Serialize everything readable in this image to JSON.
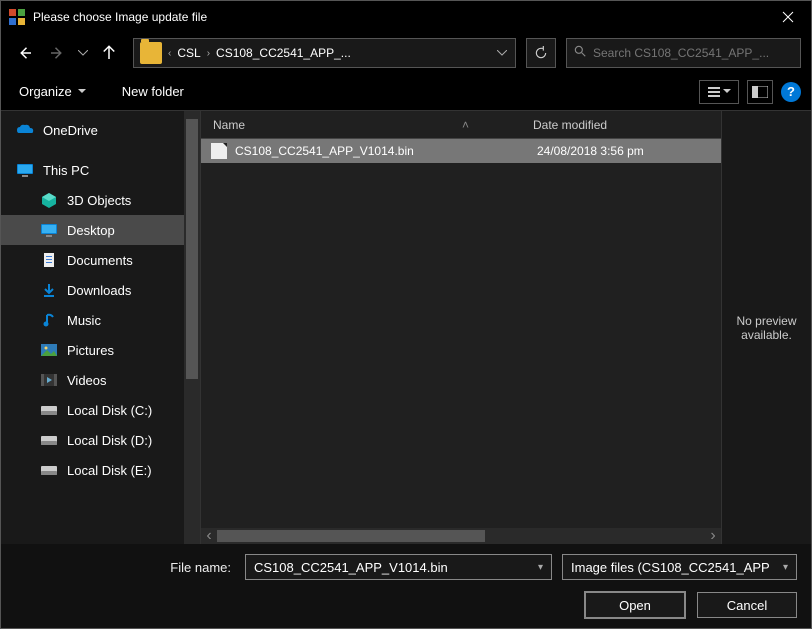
{
  "title": "Please choose Image update file",
  "breadcrumbs": [
    "CSL",
    "CS108_CC2541_APP_..."
  ],
  "search_placeholder": "Search CS108_CC2541_APP_...",
  "toolbar": {
    "organize": "Organize",
    "newfolder": "New folder",
    "help_symbol": "?"
  },
  "columns": {
    "name": "Name",
    "date": "Date modified"
  },
  "sidebar": [
    {
      "label": "OneDrive",
      "kind": "onedrive",
      "level": 0
    },
    {
      "label": "This PC",
      "kind": "thispc",
      "level": 0
    },
    {
      "label": "3D Objects",
      "kind": "3d",
      "level": 2
    },
    {
      "label": "Desktop",
      "kind": "desktop",
      "level": 2,
      "selected": true
    },
    {
      "label": "Documents",
      "kind": "docs",
      "level": 2
    },
    {
      "label": "Downloads",
      "kind": "downloads",
      "level": 2
    },
    {
      "label": "Music",
      "kind": "music",
      "level": 2
    },
    {
      "label": "Pictures",
      "kind": "pictures",
      "level": 2
    },
    {
      "label": "Videos",
      "kind": "videos",
      "level": 2
    },
    {
      "label": "Local Disk (C:)",
      "kind": "disk",
      "level": 2
    },
    {
      "label": "Local Disk (D:)",
      "kind": "disk",
      "level": 2
    },
    {
      "label": "Local Disk (E:)",
      "kind": "disk",
      "level": 2
    }
  ],
  "files": [
    {
      "name": "CS108_CC2541_APP_V1014.bin",
      "date": "24/08/2018 3:56 pm",
      "selected": true
    }
  ],
  "preview_text": "No preview available.",
  "footer": {
    "filename_label": "File name:",
    "filename_value": "CS108_CC2541_APP_V1014.bin",
    "filter_value": "Image files (CS108_CC2541_APP",
    "open": "Open",
    "cancel": "Cancel"
  }
}
